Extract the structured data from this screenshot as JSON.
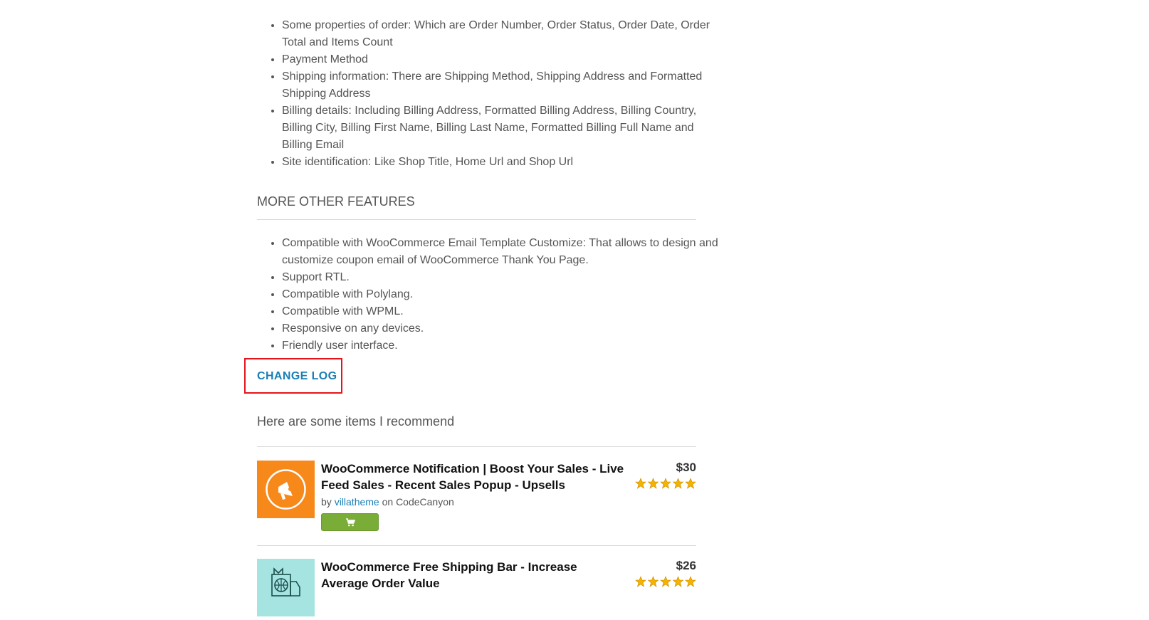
{
  "order_properties": [
    "Some properties of order: Which are Order Number, Order Status, Order Date, Order Total and Items Count",
    "Payment Method",
    "Shipping information: There are Shipping Method, Shipping Address and Formatted Shipping Address",
    "Billing details: Including Billing Address, Formatted Billing Address, Billing Country, Billing City, Billing First Name, Billing Last Name, Formatted Billing Full Name and Billing Email",
    "Site identification: Like Shop Title, Home Url and Shop Url"
  ],
  "more_features": {
    "heading": "MORE OTHER FEATURES",
    "items": [
      "Compatible with WooCommerce Email Template Customize: That allows to design and customize coupon email of WooCommerce Thank You Page.",
      "Support RTL.",
      "Compatible with Polylang.",
      "Compatible with WPML.",
      "Responsive on any devices.",
      "Friendly user interface."
    ]
  },
  "change_log": {
    "label": "CHANGE LOG"
  },
  "recommend": {
    "heading": "Here are some items I recommend",
    "items": [
      {
        "title": "WooCommerce Notification | Boost Your Sales - Live Feed Sales - Recent Sales Popup - Upsells",
        "price": "$30",
        "by": "by",
        "author": "villatheme",
        "on": "on CodeCanyon",
        "rating": 5,
        "icon": "megaphone-icon"
      },
      {
        "title": "WooCommerce Free Shipping Bar - Increase Average Order Value",
        "price": "$26",
        "rating": 5,
        "icon": "globe-truck-icon"
      }
    ]
  }
}
